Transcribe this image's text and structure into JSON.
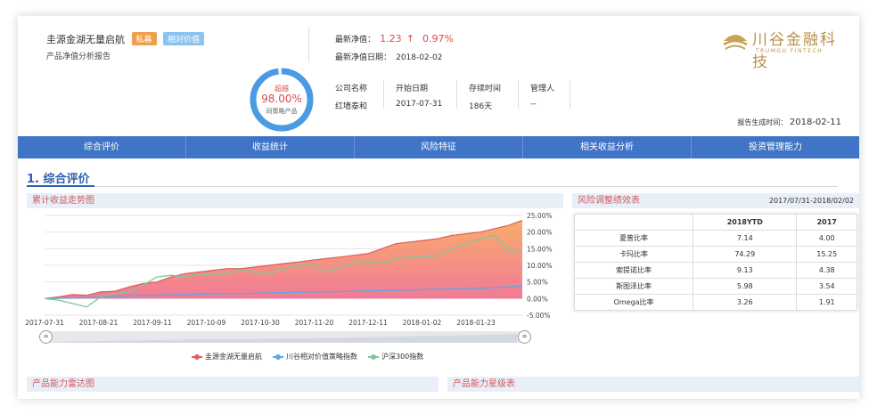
{
  "header": {
    "fund_name": "圭源金湖无量启航",
    "tag_private": "私募",
    "tag_relative": "相对价值",
    "report_title": "产品净值分析报告",
    "nav_label": "最新净值：",
    "nav_value": "1.23",
    "nav_arrow": "↑",
    "nav_change": "0.97%",
    "nav_date_label": "最新净值日期：",
    "nav_date": "2018-02-02",
    "gauge_top": "超越",
    "gauge_value": "98.00%",
    "gauge_bottom": "同策略产品",
    "gauge_fraction": 0.98,
    "info_headers": [
      "公司名称",
      "开始日期",
      "存续时间",
      "管理人"
    ],
    "info_values": [
      "红墙泰和",
      "2017-07-31",
      "186天",
      "--"
    ],
    "report_time_label": "报告生成时间：",
    "report_time": "2018-02-11",
    "logo_text": "川谷金融科技",
    "logo_sub": "TRUMGU FINTECH"
  },
  "tabs": [
    "综合评价",
    "收益统计",
    "风险特征",
    "相关收益分析",
    "投资管理能力"
  ],
  "section": {
    "title": "1. 综合评价",
    "chart_head": "累计收益走势图",
    "risk_head": "风险调整绩效表",
    "risk_period": "2017/07/31-2018/02/02",
    "radar_head": "产品能力雷达图",
    "star_head": "产品能力星级表"
  },
  "risk_table": {
    "columns": [
      "",
      "2018YTD",
      "2017"
    ],
    "rows": [
      [
        "夏普比率",
        "7.14",
        "4.00"
      ],
      [
        "卡玛比率",
        "74.29",
        "15.25"
      ],
      [
        "索提诺比率",
        "9.13",
        "4.38"
      ],
      [
        "斯图泽比率",
        "5.98",
        "3.54"
      ],
      [
        "Omega比率",
        "3.26",
        "1.91"
      ]
    ]
  },
  "chart_data": {
    "type": "area",
    "x_ticks": [
      "2017-07-31",
      "2017-08-21",
      "2017-09-11",
      "2017-10-09",
      "2017-10-30",
      "2017-11-20",
      "2017-12-11",
      "2018-01-02",
      "2018-01-23"
    ],
    "y_ticks": [
      "25.00%",
      "20.00%",
      "15.00%",
      "10.00%",
      "5.00%",
      "0.00%",
      "-5.00%"
    ],
    "ylim": [
      -5,
      25
    ],
    "grid": true,
    "legend_position": "bottom",
    "series": [
      {
        "name": "圭源金湖无量启航",
        "color": "#e25c5c",
        "values": [
          0.0,
          0.5,
          1.2,
          1.0,
          2.0,
          2.2,
          3.5,
          4.5,
          5.0,
          6.5,
          7.5,
          8.0,
          8.5,
          9.0,
          9.0,
          9.5,
          10.0,
          10.5,
          11.0,
          11.5,
          12.0,
          12.5,
          13.0,
          13.5,
          15.0,
          16.5,
          17.0,
          17.5,
          18.0,
          19.0,
          19.5,
          20.0,
          21.0,
          22.0,
          23.5
        ]
      },
      {
        "name": "川谷相对价值策略指数",
        "color": "#5aa8e6",
        "values": [
          0.0,
          0.1,
          0.2,
          0.3,
          0.5,
          0.7,
          0.8,
          0.9,
          1.0,
          1.1,
          1.2,
          1.3,
          1.4,
          1.5,
          1.5,
          1.6,
          1.7,
          1.8,
          1.9,
          2.0,
          2.0,
          2.1,
          2.2,
          2.3,
          2.4,
          2.5,
          2.6,
          2.7,
          2.8,
          2.9,
          3.0,
          3.1,
          3.3,
          3.5,
          3.8
        ]
      },
      {
        "name": "沪深300指数",
        "color": "#7fc79a",
        "values": [
          0.0,
          -0.5,
          -1.5,
          -2.5,
          0.5,
          1.5,
          2.0,
          4.0,
          6.5,
          7.0,
          6.5,
          7.5,
          7.0,
          7.8,
          8.5,
          8.0,
          7.5,
          9.0,
          10.0,
          10.5,
          8.0,
          9.5,
          10.5,
          11.0,
          10.5,
          12.0,
          12.5,
          12.5,
          13.0,
          15.0,
          16.5,
          18.0,
          19.0,
          14.5,
          14.0
        ]
      }
    ]
  }
}
